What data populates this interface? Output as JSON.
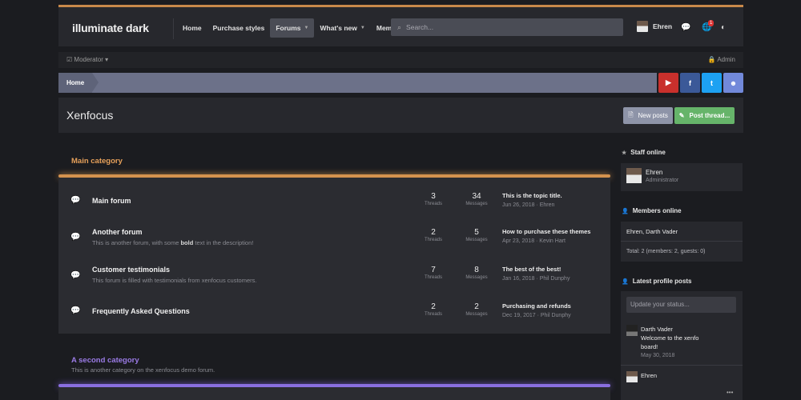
{
  "header": {
    "logo": "illuminate dark",
    "nav": [
      {
        "label": "Home",
        "dropdown": false,
        "active": false
      },
      {
        "label": "Purchase styles",
        "dropdown": false,
        "active": false
      },
      {
        "label": "Forums",
        "dropdown": true,
        "active": true
      },
      {
        "label": "What's new",
        "dropdown": true,
        "active": false
      },
      {
        "label": "Members",
        "dropdown": true,
        "active": false
      }
    ],
    "search_placeholder": "Search...",
    "username": "Ehren",
    "alert_count": "1"
  },
  "subbar": {
    "moderator": "Moderator",
    "admin": "Admin"
  },
  "breadcrumb": {
    "home": "Home"
  },
  "social": {
    "youtube": {
      "glyph": "▶",
      "color": "#c9302c"
    },
    "facebook": {
      "glyph": "f",
      "color": "#3b5998"
    },
    "twitter": {
      "glyph": "t",
      "color": "#1da1f2"
    },
    "discord": {
      "glyph": "☻",
      "color": "#7289da"
    }
  },
  "title_bar": {
    "title": "Xenfocus",
    "new_posts": "New posts",
    "post_thread": "Post thread..."
  },
  "category1": {
    "title": "Main category",
    "forums": [
      {
        "name": "Main forum",
        "desc": "",
        "threads": "3",
        "messages": "34",
        "last_title": "This is the topic title.",
        "last_meta": "Jun 26, 2018 · Ehren"
      },
      {
        "name": "Another forum",
        "desc_before": "This is another forum, with some ",
        "desc_bold": "bold",
        "desc_after": " text in the description!",
        "threads": "2",
        "messages": "5",
        "last_title": "How to purchase these themes",
        "last_meta": "Apr 23, 2018 · Kevin Hart"
      },
      {
        "name": "Customer testimonials",
        "desc": "This forum is filled with testimonials from xenfocus customers.",
        "threads": "7",
        "messages": "8",
        "last_title": "The best of the best!",
        "last_meta": "Jan 16, 2018 · Phil Dunphy"
      },
      {
        "name": "Frequently Asked Questions",
        "desc": "",
        "threads": "2",
        "messages": "2",
        "last_title": "Purchasing and refunds",
        "last_meta": "Dec 19, 2017 · Phil Dunphy"
      }
    ],
    "threads_label": "Threads",
    "messages_label": "Messages"
  },
  "category2": {
    "title": "A second category",
    "desc": "This is another category on the xenfocus demo forum."
  },
  "sidebar": {
    "staff": {
      "heading": "Staff online",
      "name": "Ehren",
      "role": "Administrator"
    },
    "members": {
      "heading": "Members online",
      "list": "Ehren, Darth Vader",
      "total": "Total: 2 (members: 2, guests: 0)"
    },
    "profile_posts": {
      "heading": "Latest profile posts",
      "status_placeholder": "Update your status...",
      "posts": [
        {
          "name": "Darth Vader",
          "text": "Welcome to the xenfo board!",
          "date": "May 30, 2018"
        },
        {
          "name": "Ehren",
          "text": "",
          "date": ""
        }
      ]
    }
  },
  "colors": {
    "accent_orange": "#d4924e",
    "accent_purple": "#8a6fe0",
    "post_green": "#66b46a"
  }
}
